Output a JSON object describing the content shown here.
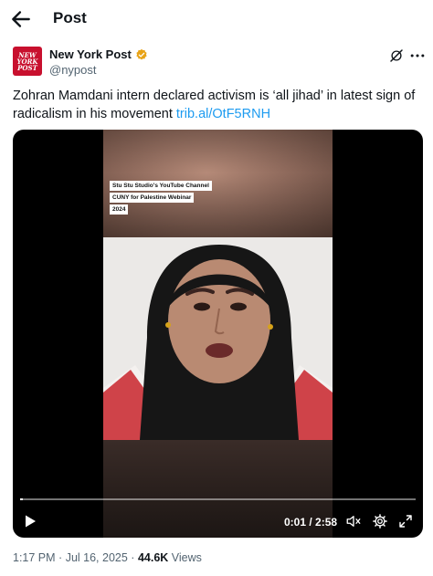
{
  "header": {
    "title": "Post",
    "back_icon": "arrow-left-icon"
  },
  "author": {
    "name": "New York Post",
    "handle": "@nypost",
    "avatar_text": [
      "NEW",
      "YORK",
      "POST"
    ],
    "verified_color": "#e8a317",
    "avatar_color": "#c8102e"
  },
  "post": {
    "text": "Zohran Mamdani intern declared activism is ‘all jihad’ in latest sign of radicalism in his movement",
    "link": "trib.al/OtF5RNH",
    "link_color": "#1d9bf0"
  },
  "video": {
    "caption_lines": [
      "Stu Stu Studio's YouTube Channel",
      "CUNY for Palestine Webinar",
      "2024"
    ],
    "time": "0:01 / 2:58",
    "progress": 0.006
  },
  "meta": {
    "time": "1:17 PM",
    "sep1": "·",
    "date": "Jul 16, 2025",
    "sep2": "·",
    "views": "44.6K",
    "views_label": "Views"
  }
}
